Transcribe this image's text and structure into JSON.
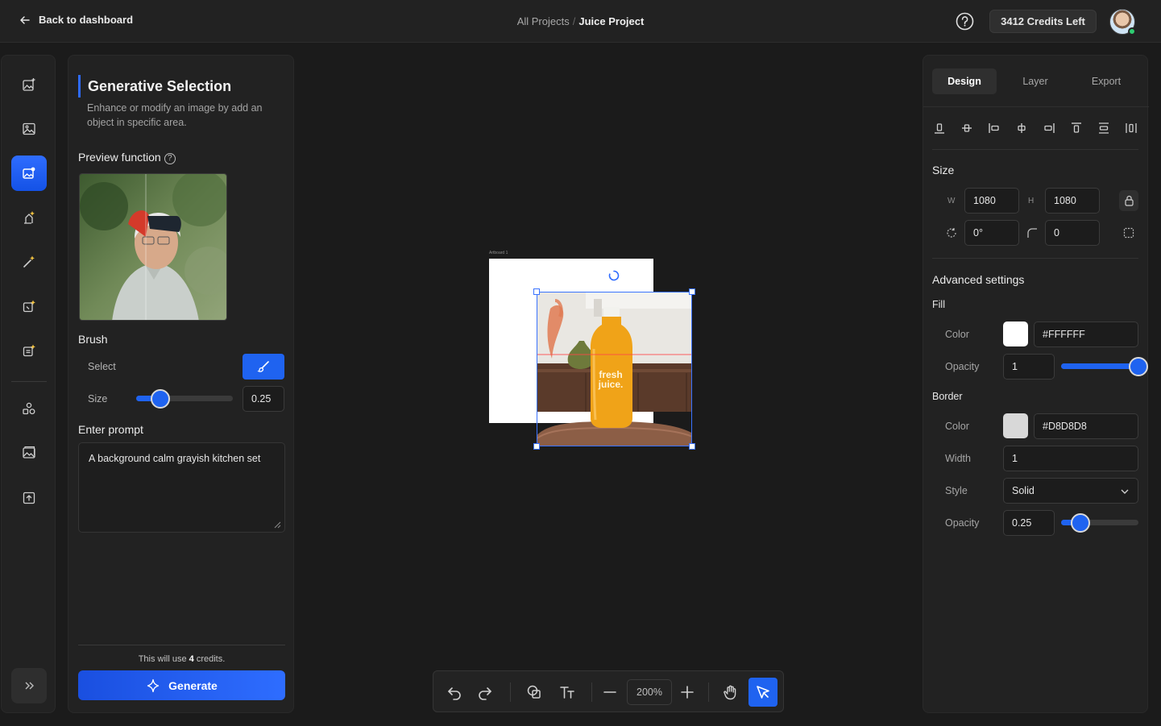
{
  "topbar": {
    "back_label": "Back to dashboard",
    "breadcrumb_root": "All Projects",
    "breadcrumb_sep": "/",
    "breadcrumb_current": "Juice Project",
    "credits_label": "3412 Credits Left"
  },
  "rail": {
    "items": [
      "image-sparkle-icon",
      "image-icon",
      "generative-selection-icon",
      "magic-fill-icon",
      "magic-wand-icon",
      "expand-image-icon",
      "replace-image-icon",
      "shapes-icon",
      "layers-image-icon",
      "upload-icon"
    ],
    "active_index": 2
  },
  "left_panel": {
    "title": "Generative Selection",
    "description": "Enhance or modify an image by add an object in specific area.",
    "preview_label": "Preview function",
    "brush_label": "Brush",
    "select_label": "Select",
    "size_label": "Size",
    "size_value": "0.25",
    "size_slider_fraction": 0.25,
    "prompt_label": "Enter prompt",
    "prompt_value": "A background calm grayish kitchen set",
    "credits_prefix": "This will use ",
    "credits_count": "4",
    "credits_suffix": " credits.",
    "generate_label": "Generate"
  },
  "canvas": {
    "artboard_label": "Artboard 1",
    "product_text_line1": "fresh",
    "product_text_line2": "juice."
  },
  "toolbar": {
    "zoom": "200%",
    "active_tool": "select-pointer"
  },
  "right_panel": {
    "tabs": [
      "Design",
      "Layer",
      "Export"
    ],
    "active_tab": 0,
    "size_heading": "Size",
    "w_label": "W",
    "w_value": "1080",
    "h_label": "H",
    "h_value": "1080",
    "rotation_value": "0°",
    "radius_value": "0",
    "advanced_heading": "Advanced settings",
    "fill_heading": "Fill",
    "fill_color_label": "Color",
    "fill_color": "#FFFFFF",
    "fill_opacity_label": "Opacity",
    "fill_opacity": "1",
    "fill_opacity_fraction": 1,
    "border_heading": "Border",
    "border_color_label": "Color",
    "border_color": "#D8D8D8",
    "border_width_label": "Width",
    "border_width": "1",
    "border_style_label": "Style",
    "border_style": "Solid",
    "border_opacity_label": "Opacity",
    "border_opacity": "0.25",
    "border_opacity_fraction": 0.25
  },
  "colors": {
    "accent": "#1F63F0",
    "panel": "#222222",
    "background": "#1B1B1B"
  }
}
